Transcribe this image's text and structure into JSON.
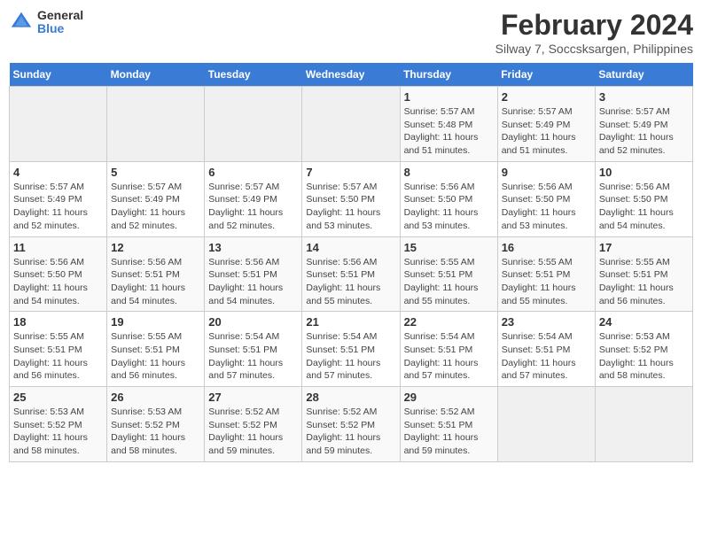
{
  "header": {
    "logo_general": "General",
    "logo_blue": "Blue",
    "title": "February 2024",
    "subtitle": "Silway 7, Soccsksargen, Philippines"
  },
  "days_of_week": [
    "Sunday",
    "Monday",
    "Tuesday",
    "Wednesday",
    "Thursday",
    "Friday",
    "Saturday"
  ],
  "weeks": [
    [
      {
        "day": "",
        "info": ""
      },
      {
        "day": "",
        "info": ""
      },
      {
        "day": "",
        "info": ""
      },
      {
        "day": "",
        "info": ""
      },
      {
        "day": "1",
        "info": "Sunrise: 5:57 AM\nSunset: 5:48 PM\nDaylight: 11 hours\nand 51 minutes."
      },
      {
        "day": "2",
        "info": "Sunrise: 5:57 AM\nSunset: 5:49 PM\nDaylight: 11 hours\nand 51 minutes."
      },
      {
        "day": "3",
        "info": "Sunrise: 5:57 AM\nSunset: 5:49 PM\nDaylight: 11 hours\nand 52 minutes."
      }
    ],
    [
      {
        "day": "4",
        "info": "Sunrise: 5:57 AM\nSunset: 5:49 PM\nDaylight: 11 hours\nand 52 minutes."
      },
      {
        "day": "5",
        "info": "Sunrise: 5:57 AM\nSunset: 5:49 PM\nDaylight: 11 hours\nand 52 minutes."
      },
      {
        "day": "6",
        "info": "Sunrise: 5:57 AM\nSunset: 5:49 PM\nDaylight: 11 hours\nand 52 minutes."
      },
      {
        "day": "7",
        "info": "Sunrise: 5:57 AM\nSunset: 5:50 PM\nDaylight: 11 hours\nand 53 minutes."
      },
      {
        "day": "8",
        "info": "Sunrise: 5:56 AM\nSunset: 5:50 PM\nDaylight: 11 hours\nand 53 minutes."
      },
      {
        "day": "9",
        "info": "Sunrise: 5:56 AM\nSunset: 5:50 PM\nDaylight: 11 hours\nand 53 minutes."
      },
      {
        "day": "10",
        "info": "Sunrise: 5:56 AM\nSunset: 5:50 PM\nDaylight: 11 hours\nand 54 minutes."
      }
    ],
    [
      {
        "day": "11",
        "info": "Sunrise: 5:56 AM\nSunset: 5:50 PM\nDaylight: 11 hours\nand 54 minutes."
      },
      {
        "day": "12",
        "info": "Sunrise: 5:56 AM\nSunset: 5:51 PM\nDaylight: 11 hours\nand 54 minutes."
      },
      {
        "day": "13",
        "info": "Sunrise: 5:56 AM\nSunset: 5:51 PM\nDaylight: 11 hours\nand 54 minutes."
      },
      {
        "day": "14",
        "info": "Sunrise: 5:56 AM\nSunset: 5:51 PM\nDaylight: 11 hours\nand 55 minutes."
      },
      {
        "day": "15",
        "info": "Sunrise: 5:55 AM\nSunset: 5:51 PM\nDaylight: 11 hours\nand 55 minutes."
      },
      {
        "day": "16",
        "info": "Sunrise: 5:55 AM\nSunset: 5:51 PM\nDaylight: 11 hours\nand 55 minutes."
      },
      {
        "day": "17",
        "info": "Sunrise: 5:55 AM\nSunset: 5:51 PM\nDaylight: 11 hours\nand 56 minutes."
      }
    ],
    [
      {
        "day": "18",
        "info": "Sunrise: 5:55 AM\nSunset: 5:51 PM\nDaylight: 11 hours\nand 56 minutes."
      },
      {
        "day": "19",
        "info": "Sunrise: 5:55 AM\nSunset: 5:51 PM\nDaylight: 11 hours\nand 56 minutes."
      },
      {
        "day": "20",
        "info": "Sunrise: 5:54 AM\nSunset: 5:51 PM\nDaylight: 11 hours\nand 57 minutes."
      },
      {
        "day": "21",
        "info": "Sunrise: 5:54 AM\nSunset: 5:51 PM\nDaylight: 11 hours\nand 57 minutes."
      },
      {
        "day": "22",
        "info": "Sunrise: 5:54 AM\nSunset: 5:51 PM\nDaylight: 11 hours\nand 57 minutes."
      },
      {
        "day": "23",
        "info": "Sunrise: 5:54 AM\nSunset: 5:51 PM\nDaylight: 11 hours\nand 57 minutes."
      },
      {
        "day": "24",
        "info": "Sunrise: 5:53 AM\nSunset: 5:52 PM\nDaylight: 11 hours\nand 58 minutes."
      }
    ],
    [
      {
        "day": "25",
        "info": "Sunrise: 5:53 AM\nSunset: 5:52 PM\nDaylight: 11 hours\nand 58 minutes."
      },
      {
        "day": "26",
        "info": "Sunrise: 5:53 AM\nSunset: 5:52 PM\nDaylight: 11 hours\nand 58 minutes."
      },
      {
        "day": "27",
        "info": "Sunrise: 5:52 AM\nSunset: 5:52 PM\nDaylight: 11 hours\nand 59 minutes."
      },
      {
        "day": "28",
        "info": "Sunrise: 5:52 AM\nSunset: 5:52 PM\nDaylight: 11 hours\nand 59 minutes."
      },
      {
        "day": "29",
        "info": "Sunrise: 5:52 AM\nSunset: 5:51 PM\nDaylight: 11 hours\nand 59 minutes."
      },
      {
        "day": "",
        "info": ""
      },
      {
        "day": "",
        "info": ""
      }
    ]
  ]
}
